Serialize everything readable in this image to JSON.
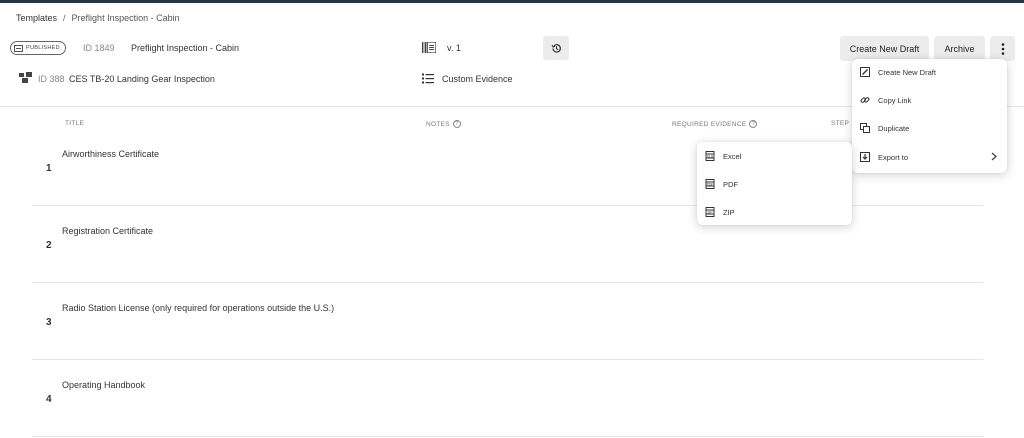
{
  "breadcrumb": {
    "root": "Templates",
    "separator": "/",
    "current": "Preflight Inspection - Cabin"
  },
  "template": {
    "status": "PUBLISHED",
    "id": "ID 1849",
    "name": "Preflight Inspection - Cabin",
    "version": "v. 1"
  },
  "aircraft": {
    "id": "ID 388",
    "name": "CES TB-20 Landing Gear Inspection"
  },
  "evidence": {
    "label": "Custom Evidence"
  },
  "toolbar": {
    "create_draft": "Create New Draft",
    "archive": "Archive"
  },
  "table": {
    "columns": {
      "title": "TITLE",
      "notes": "NOTES",
      "required_evidence": "REQUIRED EVIDENCE",
      "step": "STEP"
    },
    "rows": [
      {
        "num": "1",
        "title": "Airworthiness Certificate"
      },
      {
        "num": "2",
        "title": "Registration Certificate"
      },
      {
        "num": "3",
        "title": "Radio Station License (only required for operations outside the U.S.)"
      },
      {
        "num": "4",
        "title": "Operating Handbook"
      }
    ]
  },
  "more_menu": {
    "items": [
      {
        "label": "Create New Draft",
        "icon": "edit-icon"
      },
      {
        "label": "Copy Link",
        "icon": "link-icon"
      },
      {
        "label": "Duplicate",
        "icon": "duplicate-icon"
      },
      {
        "label": "Export to",
        "icon": "export-icon"
      }
    ]
  },
  "export_menu": {
    "items": [
      {
        "label": "Excel",
        "icon": "excel-file-icon"
      },
      {
        "label": "PDF",
        "icon": "pdf-file-icon"
      },
      {
        "label": "ZIP",
        "icon": "zip-file-icon"
      }
    ]
  },
  "colors": {
    "topbar": "#263544",
    "button_bg": "#ececec"
  }
}
